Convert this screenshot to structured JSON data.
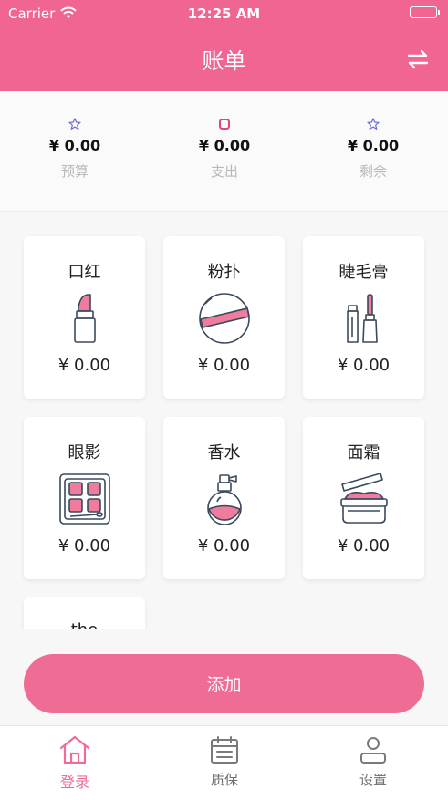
{
  "status_bar": {
    "carrier": "Carrier",
    "time": "12:25 AM"
  },
  "nav": {
    "title": "账单"
  },
  "summary": [
    {
      "value": "¥ 0.00",
      "label": "预算",
      "icon": "star-icon"
    },
    {
      "value": "¥ 0.00",
      "label": "支出",
      "icon": "square-icon"
    },
    {
      "value": "¥ 0.00",
      "label": "剩余",
      "icon": "star-icon"
    }
  ],
  "items": [
    {
      "name": "口红",
      "price": "¥ 0.00",
      "icon": "lipstick-icon"
    },
    {
      "name": "粉扑",
      "price": "¥ 0.00",
      "icon": "powder-puff-icon"
    },
    {
      "name": "睫毛膏",
      "price": "¥ 0.00",
      "icon": "mascara-icon"
    },
    {
      "name": "眼影",
      "price": "¥ 0.00",
      "icon": "eyeshadow-palette-icon"
    },
    {
      "name": "香水",
      "price": "¥ 0.00",
      "icon": "perfume-icon"
    },
    {
      "name": "面霜",
      "price": "¥ 0.00",
      "icon": "face-cream-icon"
    },
    {
      "name": "the",
      "price": "",
      "icon": ""
    }
  ],
  "add_button": {
    "label": "添加"
  },
  "tabs": [
    {
      "label": "登录",
      "icon": "home-icon",
      "active": true
    },
    {
      "label": "质保",
      "icon": "calendar-icon",
      "active": false
    },
    {
      "label": "设置",
      "icon": "user-icon",
      "active": false
    }
  ],
  "colors": {
    "accent": "#f06592",
    "button": "#ef6d95",
    "star": "#6b6bd6",
    "square": "#e04a6a"
  }
}
